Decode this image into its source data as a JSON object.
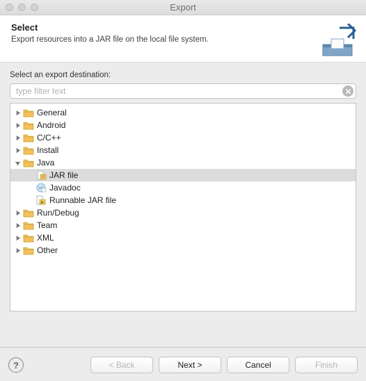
{
  "window": {
    "title": "Export"
  },
  "header": {
    "title": "Select",
    "description": "Export resources into a JAR file on the local file system."
  },
  "section_label": "Select an export destination:",
  "filter": {
    "placeholder": "type filter text"
  },
  "tree": {
    "items": [
      {
        "label": "General",
        "expanded": false,
        "depth": 0,
        "icon": "folder",
        "selected": false
      },
      {
        "label": "Android",
        "expanded": false,
        "depth": 0,
        "icon": "folder",
        "selected": false
      },
      {
        "label": "C/C++",
        "expanded": false,
        "depth": 0,
        "icon": "folder",
        "selected": false
      },
      {
        "label": "Install",
        "expanded": false,
        "depth": 0,
        "icon": "folder",
        "selected": false
      },
      {
        "label": "Java",
        "expanded": true,
        "depth": 0,
        "icon": "folder",
        "selected": false
      },
      {
        "label": "JAR file",
        "depth": 1,
        "icon": "jar",
        "selected": true
      },
      {
        "label": "Javadoc",
        "depth": 1,
        "icon": "javadoc",
        "selected": false
      },
      {
        "label": "Runnable JAR file",
        "depth": 1,
        "icon": "runjar",
        "selected": false
      },
      {
        "label": "Run/Debug",
        "expanded": false,
        "depth": 0,
        "icon": "folder",
        "selected": false
      },
      {
        "label": "Team",
        "expanded": false,
        "depth": 0,
        "icon": "folder",
        "selected": false
      },
      {
        "label": "XML",
        "expanded": false,
        "depth": 0,
        "icon": "folder",
        "selected": false
      },
      {
        "label": "Other",
        "expanded": false,
        "depth": 0,
        "icon": "folder",
        "selected": false
      }
    ]
  },
  "buttons": {
    "back": "< Back",
    "next": "Next >",
    "cancel": "Cancel",
    "finish": "Finish"
  },
  "icons": {
    "folder_fill": "#f3c05a",
    "folder_stroke": "#caa02f"
  }
}
